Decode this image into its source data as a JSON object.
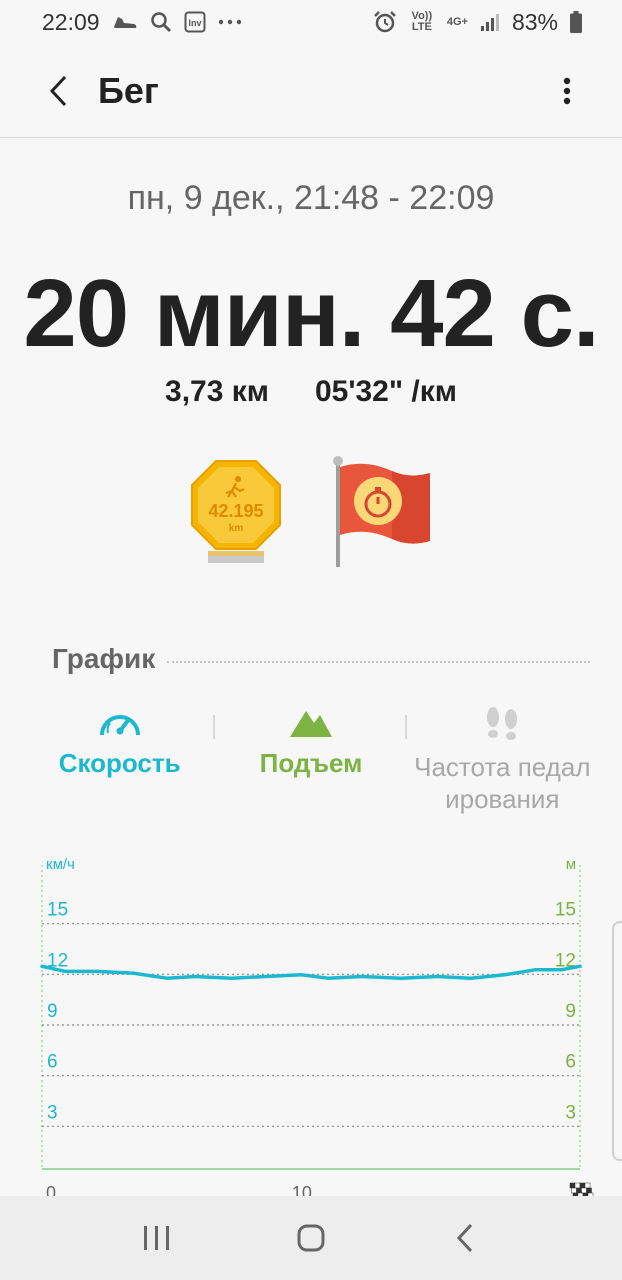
{
  "status_bar": {
    "time": "22:09",
    "battery": "83%",
    "lte": "Vo)) LTE",
    "net": "4G+",
    "icons": [
      "shoe-icon",
      "search-icon",
      "app-icon",
      "more-dots-icon",
      "alarm-icon",
      "signal-icon",
      "battery-icon"
    ]
  },
  "app_bar": {
    "title": "Бег"
  },
  "workout": {
    "date_range": "пн, 9 дек., 21:48 - 22:09",
    "duration": "20 мин. 42 с.",
    "distance": "3,73 км",
    "pace": "05'32\" /км"
  },
  "badges": {
    "marathon_label": "42.195",
    "marathon_unit": "km"
  },
  "graph": {
    "title": "График",
    "tabs": [
      {
        "label": "Скорость",
        "color": "#1cb8cf",
        "icon": "speedometer-icon"
      },
      {
        "label": "Подъем",
        "color": "#7cb342",
        "icon": "mountain-icon"
      },
      {
        "label": "Частота педалирования",
        "label_line1": "Частота педал",
        "label_line2": "ирования",
        "color": "#a8a8a8",
        "icon": "footsteps-icon"
      }
    ]
  },
  "chart_data": {
    "type": "line",
    "left_axis_unit": "км/ч",
    "right_axis_unit": "м",
    "y_ticks": [
      3,
      6,
      9,
      12,
      15
    ],
    "ylim": [
      0,
      18
    ],
    "x_ticks": [
      "0",
      "10"
    ],
    "xlim": [
      0,
      20.7
    ],
    "grid": true,
    "series": [
      {
        "color": "#1cb8cf",
        "x": [
          0,
          0.9,
          2.1,
          3.5,
          4.8,
          5.9,
          7.3,
          8.6,
          10.0,
          11.0,
          12.3,
          13.8,
          15.2,
          16.5,
          17.8,
          19.0,
          20.0,
          20.7
        ],
        "values": [
          12.0,
          11.7,
          11.7,
          11.6,
          11.3,
          11.4,
          11.3,
          11.4,
          11.5,
          11.3,
          11.4,
          11.3,
          11.4,
          11.3,
          11.5,
          11.8,
          11.8,
          12.0
        ]
      }
    ]
  },
  "nav": {
    "icons": [
      "recent-apps-icon",
      "home-icon",
      "back-nav-icon"
    ]
  }
}
